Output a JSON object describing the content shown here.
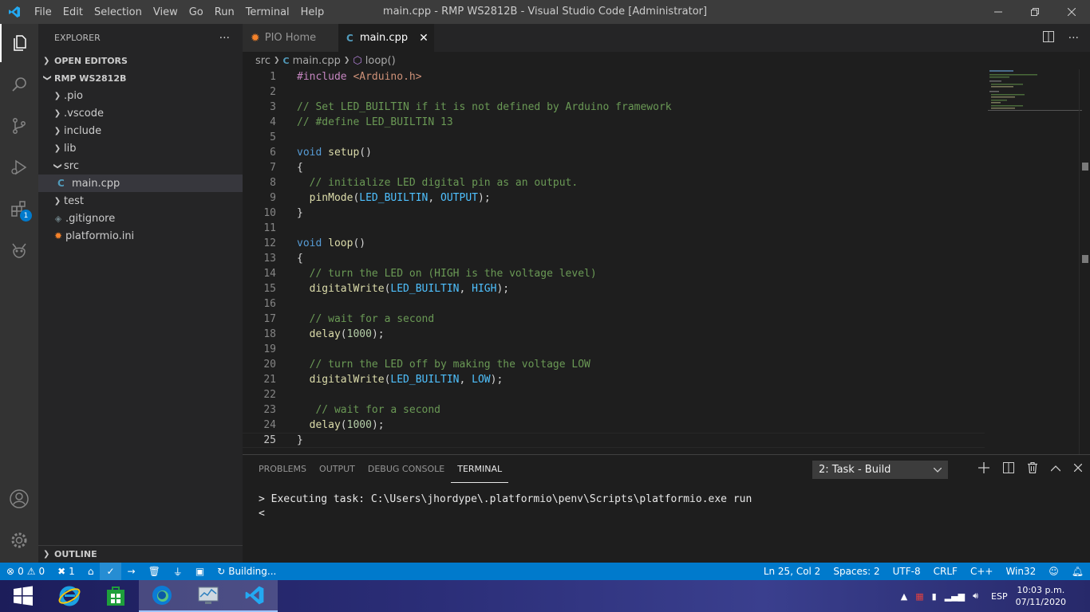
{
  "titlebar": {
    "menu": [
      "File",
      "Edit",
      "Selection",
      "View",
      "Go",
      "Run",
      "Terminal",
      "Help"
    ],
    "title": "main.cpp - RMP WS2812B - Visual Studio Code [Administrator]"
  },
  "activity": {
    "extensions_badge": "1"
  },
  "sidebar": {
    "header": "EXPLORER",
    "more": "···",
    "open_editors": "OPEN EDITORS",
    "project": "RMP WS2812B",
    "items": [
      {
        "label": ".pio",
        "type": "folder"
      },
      {
        "label": ".vscode",
        "type": "folder"
      },
      {
        "label": "include",
        "type": "folder"
      },
      {
        "label": "lib",
        "type": "folder"
      },
      {
        "label": "src",
        "type": "folder-open"
      },
      {
        "label": "main.cpp",
        "type": "file-cpp"
      },
      {
        "label": "test",
        "type": "folder"
      },
      {
        "label": ".gitignore",
        "type": "file-git"
      },
      {
        "label": "platformio.ini",
        "type": "file-pio"
      }
    ],
    "outline": "OUTLINE"
  },
  "tabs": [
    {
      "label": "PIO Home",
      "active": false
    },
    {
      "label": "main.cpp",
      "active": true
    }
  ],
  "breadcrumb": [
    "src",
    "main.cpp",
    "loop()"
  ],
  "editor": {
    "line_numbers": [
      "1",
      "2",
      "3",
      "4",
      "5",
      "6",
      "7",
      "8",
      "9",
      "10",
      "11",
      "12",
      "13",
      "14",
      "15",
      "16",
      "17",
      "18",
      "19",
      "20",
      "21",
      "22",
      "23",
      "24",
      "25"
    ],
    "lines": [
      "#include <Arduino.h>",
      "",
      "// Set LED_BUILTIN if it is not defined by Arduino framework",
      "// #define LED_BUILTIN 13",
      "",
      "void setup()",
      "{",
      "  // initialize LED digital pin as an output.",
      "  pinMode(LED_BUILTIN, OUTPUT);",
      "}",
      "",
      "void loop()",
      "{",
      "  // turn the LED on (HIGH is the voltage level)",
      "  digitalWrite(LED_BUILTIN, HIGH);",
      "",
      "  // wait for a second",
      "  delay(1000);",
      "",
      "  // turn the LED off by making the voltage LOW",
      "  digitalWrite(LED_BUILTIN, LOW);",
      "",
      "   // wait for a second",
      "  delay(1000);",
      "}"
    ]
  },
  "panel": {
    "tabs": [
      "PROBLEMS",
      "OUTPUT",
      "DEBUG CONSOLE",
      "TERMINAL"
    ],
    "active_tab": "TERMINAL",
    "task_select": "2: Task - Build",
    "terminal_lines": [
      "> Executing task: C:\\Users\\jhordype\\.platformio\\penv\\Scripts\\platformio.exe run",
      "<"
    ]
  },
  "statusbar": {
    "errors": "0",
    "warnings": "0",
    "tools": "1",
    "building": "Building...",
    "position": "Ln 25, Col 2",
    "spaces": "Spaces: 2",
    "encoding": "UTF-8",
    "eol": "CRLF",
    "language": "C++",
    "platform": "Win32"
  },
  "taskbar": {
    "language": "ESP",
    "time": "10:03 p.m.",
    "date": "07/11/2020"
  },
  "colors": {
    "accent": "#007acc",
    "titlebar": "#3c3c3c",
    "sidebar": "#252526",
    "editor": "#1e1e1e"
  }
}
